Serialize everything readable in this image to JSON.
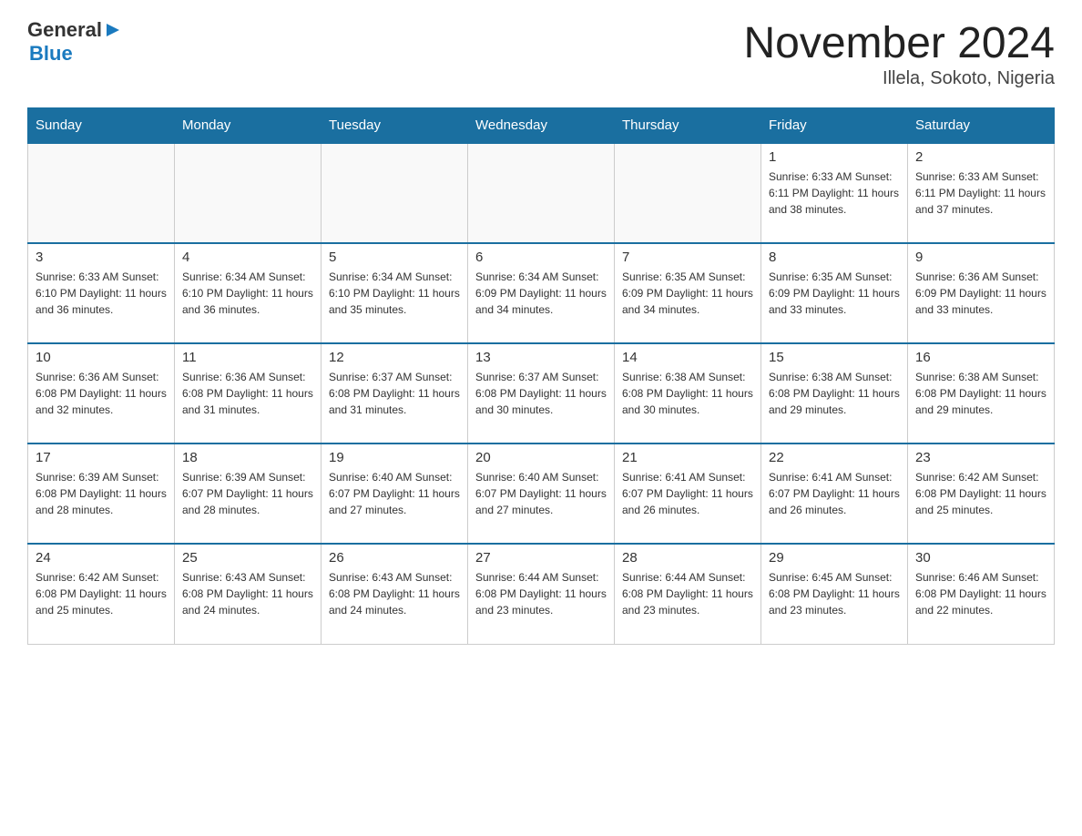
{
  "header": {
    "logo_general": "General",
    "logo_blue": "Blue",
    "title": "November 2024",
    "subtitle": "Illela, Sokoto, Nigeria"
  },
  "weekdays": [
    "Sunday",
    "Monday",
    "Tuesday",
    "Wednesday",
    "Thursday",
    "Friday",
    "Saturday"
  ],
  "weeks": [
    [
      {
        "day": "",
        "info": ""
      },
      {
        "day": "",
        "info": ""
      },
      {
        "day": "",
        "info": ""
      },
      {
        "day": "",
        "info": ""
      },
      {
        "day": "",
        "info": ""
      },
      {
        "day": "1",
        "info": "Sunrise: 6:33 AM\nSunset: 6:11 PM\nDaylight: 11 hours\nand 38 minutes."
      },
      {
        "day": "2",
        "info": "Sunrise: 6:33 AM\nSunset: 6:11 PM\nDaylight: 11 hours\nand 37 minutes."
      }
    ],
    [
      {
        "day": "3",
        "info": "Sunrise: 6:33 AM\nSunset: 6:10 PM\nDaylight: 11 hours\nand 36 minutes."
      },
      {
        "day": "4",
        "info": "Sunrise: 6:34 AM\nSunset: 6:10 PM\nDaylight: 11 hours\nand 36 minutes."
      },
      {
        "day": "5",
        "info": "Sunrise: 6:34 AM\nSunset: 6:10 PM\nDaylight: 11 hours\nand 35 minutes."
      },
      {
        "day": "6",
        "info": "Sunrise: 6:34 AM\nSunset: 6:09 PM\nDaylight: 11 hours\nand 34 minutes."
      },
      {
        "day": "7",
        "info": "Sunrise: 6:35 AM\nSunset: 6:09 PM\nDaylight: 11 hours\nand 34 minutes."
      },
      {
        "day": "8",
        "info": "Sunrise: 6:35 AM\nSunset: 6:09 PM\nDaylight: 11 hours\nand 33 minutes."
      },
      {
        "day": "9",
        "info": "Sunrise: 6:36 AM\nSunset: 6:09 PM\nDaylight: 11 hours\nand 33 minutes."
      }
    ],
    [
      {
        "day": "10",
        "info": "Sunrise: 6:36 AM\nSunset: 6:08 PM\nDaylight: 11 hours\nand 32 minutes."
      },
      {
        "day": "11",
        "info": "Sunrise: 6:36 AM\nSunset: 6:08 PM\nDaylight: 11 hours\nand 31 minutes."
      },
      {
        "day": "12",
        "info": "Sunrise: 6:37 AM\nSunset: 6:08 PM\nDaylight: 11 hours\nand 31 minutes."
      },
      {
        "day": "13",
        "info": "Sunrise: 6:37 AM\nSunset: 6:08 PM\nDaylight: 11 hours\nand 30 minutes."
      },
      {
        "day": "14",
        "info": "Sunrise: 6:38 AM\nSunset: 6:08 PM\nDaylight: 11 hours\nand 30 minutes."
      },
      {
        "day": "15",
        "info": "Sunrise: 6:38 AM\nSunset: 6:08 PM\nDaylight: 11 hours\nand 29 minutes."
      },
      {
        "day": "16",
        "info": "Sunrise: 6:38 AM\nSunset: 6:08 PM\nDaylight: 11 hours\nand 29 minutes."
      }
    ],
    [
      {
        "day": "17",
        "info": "Sunrise: 6:39 AM\nSunset: 6:08 PM\nDaylight: 11 hours\nand 28 minutes."
      },
      {
        "day": "18",
        "info": "Sunrise: 6:39 AM\nSunset: 6:07 PM\nDaylight: 11 hours\nand 28 minutes."
      },
      {
        "day": "19",
        "info": "Sunrise: 6:40 AM\nSunset: 6:07 PM\nDaylight: 11 hours\nand 27 minutes."
      },
      {
        "day": "20",
        "info": "Sunrise: 6:40 AM\nSunset: 6:07 PM\nDaylight: 11 hours\nand 27 minutes."
      },
      {
        "day": "21",
        "info": "Sunrise: 6:41 AM\nSunset: 6:07 PM\nDaylight: 11 hours\nand 26 minutes."
      },
      {
        "day": "22",
        "info": "Sunrise: 6:41 AM\nSunset: 6:07 PM\nDaylight: 11 hours\nand 26 minutes."
      },
      {
        "day": "23",
        "info": "Sunrise: 6:42 AM\nSunset: 6:08 PM\nDaylight: 11 hours\nand 25 minutes."
      }
    ],
    [
      {
        "day": "24",
        "info": "Sunrise: 6:42 AM\nSunset: 6:08 PM\nDaylight: 11 hours\nand 25 minutes."
      },
      {
        "day": "25",
        "info": "Sunrise: 6:43 AM\nSunset: 6:08 PM\nDaylight: 11 hours\nand 24 minutes."
      },
      {
        "day": "26",
        "info": "Sunrise: 6:43 AM\nSunset: 6:08 PM\nDaylight: 11 hours\nand 24 minutes."
      },
      {
        "day": "27",
        "info": "Sunrise: 6:44 AM\nSunset: 6:08 PM\nDaylight: 11 hours\nand 23 minutes."
      },
      {
        "day": "28",
        "info": "Sunrise: 6:44 AM\nSunset: 6:08 PM\nDaylight: 11 hours\nand 23 minutes."
      },
      {
        "day": "29",
        "info": "Sunrise: 6:45 AM\nSunset: 6:08 PM\nDaylight: 11 hours\nand 23 minutes."
      },
      {
        "day": "30",
        "info": "Sunrise: 6:46 AM\nSunset: 6:08 PM\nDaylight: 11 hours\nand 22 minutes."
      }
    ]
  ]
}
